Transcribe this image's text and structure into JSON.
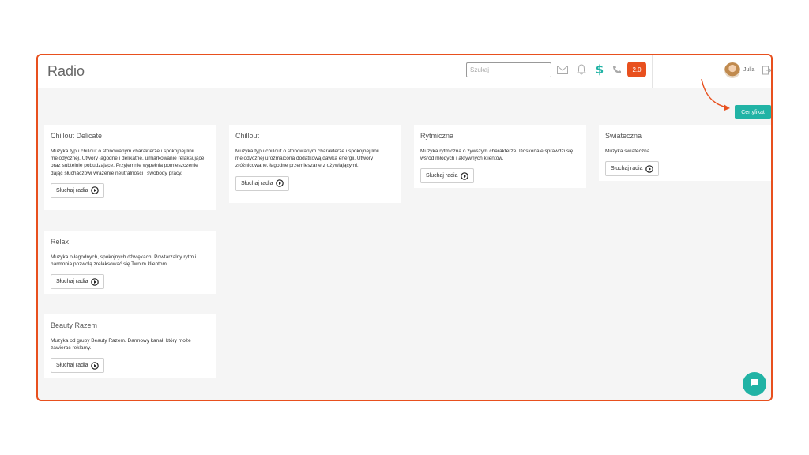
{
  "header": {
    "title": "Radio",
    "search_placeholder": "Szukaj",
    "version_badge": "2.0",
    "user_name": "Julia",
    "dollar_symbol": "$"
  },
  "certificate_button": "Certyfikat",
  "listen_label": "Słuchaj radia",
  "colors": {
    "accent": "#21b3a5",
    "brand_orange": "#e8501e",
    "frame": "#e8501e",
    "background": "#f5f5f5"
  },
  "icons": [
    "mail-icon",
    "bell-icon",
    "dollar-icon",
    "phone-icon",
    "logout-icon",
    "play-icon",
    "chat-icon",
    "arrow-icon"
  ],
  "stations": [
    {
      "name": "Chillout Delicate",
      "description": "Muzyka typu chillout o stonowanym charakterze i spokojnej linii melodycznej. Utwory łagodne i delikatne, umiarkowanie relaksujące oraz subtelnie pobudzające. Przyjemnie wypełnia pomieszczenie dając słuchaczowi wrażenie neutralności i swobody pracy."
    },
    {
      "name": "Chillout",
      "description": "Muzyka typu chillout o stonowanym charakterze i spokojnej linii melodycznej urozmaicona dodatkową dawką energii. Utwory zróżnicowane, łagodne przemieszane z ożywiającymi."
    },
    {
      "name": "Rytmiczna",
      "description": "Muzyka rytmiczna o żywszym charakterze. Doskonale sprawdzi się wśród młodych i aktywnych klientów."
    },
    {
      "name": "Swiateczna",
      "description": "Muzyka swiateczna"
    },
    {
      "name": "Relax",
      "description": "Muzyka o łagodnych, spokojnych dźwiękach. Powtarzalny rytm i harmonia pozwolą zrelaksować się Twoim klientom."
    },
    {
      "name": "Beauty Razem",
      "description": "Muzyka od grupy Beauty Razem. Darmowy kanał, który może zawierać reklamy."
    }
  ]
}
